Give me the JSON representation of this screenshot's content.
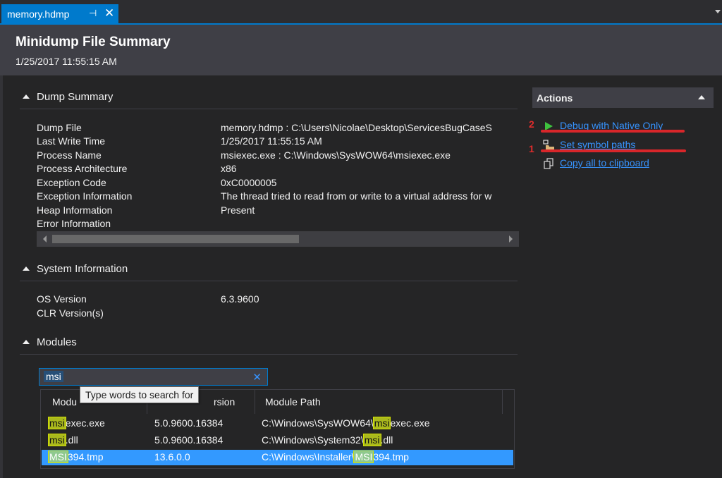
{
  "tab": {
    "title": "memory.hdmp",
    "pin_glyph": "⊣",
    "close_glyph": "✕"
  },
  "header": {
    "title": "Minidump File Summary",
    "date": "1/25/2017 11:55:15 AM"
  },
  "dump_summary": {
    "heading": "Dump Summary",
    "rows": [
      {
        "label": "Dump File",
        "value": "memory.hdmp : C:\\Users\\Nicolae\\Desktop\\ServicesBugCaseS"
      },
      {
        "label": "Last Write Time",
        "value": "1/25/2017 11:55:15 AM"
      },
      {
        "label": "Process Name",
        "value": "msiexec.exe : C:\\Windows\\SysWOW64\\msiexec.exe"
      },
      {
        "label": "Process Architecture",
        "value": "x86"
      },
      {
        "label": "Exception Code",
        "value": "0xC0000005"
      },
      {
        "label": "Exception Information",
        "value": "The thread tried to read from or write to a virtual address for w"
      },
      {
        "label": "Heap Information",
        "value": "Present"
      },
      {
        "label": "Error Information",
        "value": ""
      }
    ]
  },
  "system_info": {
    "heading": "System Information",
    "rows": [
      {
        "label": "OS Version",
        "value": "6.3.9600"
      },
      {
        "label": "CLR Version(s)",
        "value": ""
      }
    ]
  },
  "modules": {
    "heading": "Modules",
    "search_value": "msi",
    "clear_glyph": "✕",
    "tooltip": "Type words to search for",
    "columns": [
      "Modu",
      "rsion",
      "Module Path"
    ],
    "rows": [
      {
        "name_hl": "msi",
        "name_rest": "exec.exe",
        "version": "5.0.9600.16384",
        "path_pre": "C:\\Windows\\SysWOW64\\",
        "path_hl": "msi",
        "path_post": "exec.exe"
      },
      {
        "name_hl": "msi",
        "name_rest": ".dll",
        "version": "5.0.9600.16384",
        "path_pre": "C:\\Windows\\System32\\",
        "path_hl": "msi",
        "path_post": ".dll"
      },
      {
        "name_hl": "MSI",
        "name_rest": "394.tmp",
        "version": "13.6.0.0",
        "path_pre": "C:\\Windows\\Installer\\",
        "path_hl": "MSI",
        "path_post": "394.tmp"
      }
    ]
  },
  "actions": {
    "heading": "Actions",
    "items": [
      {
        "label": "Debug with Native Only",
        "icon": "play-icon",
        "annotation": "2"
      },
      {
        "label": "Set symbol paths",
        "icon": "folder-icon",
        "annotation": "1"
      },
      {
        "label": "Copy all to clipboard",
        "icon": "copy-icon",
        "annotation": ""
      }
    ]
  },
  "colors": {
    "accent": "#007acc",
    "link": "#3794ff",
    "annotation_red": "#d9262a",
    "selection": "#3399ff",
    "search_highlight": "#a9b81d"
  }
}
